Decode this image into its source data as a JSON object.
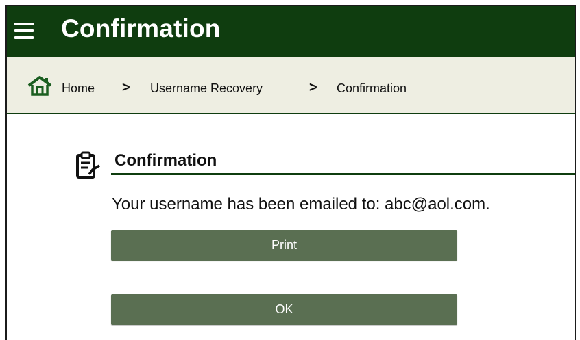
{
  "header": {
    "title": "Confirmation",
    "menu_icon": "hamburger-menu-icon",
    "background": "#0f3d0f"
  },
  "breadcrumb": {
    "home_icon": "home-icon",
    "items": [
      "Home",
      "Username Recovery",
      "Confirmation"
    ],
    "separator": ">",
    "background": "#eeeee2"
  },
  "section": {
    "icon": "clipboard-check-icon",
    "title": "Confirmation",
    "message": "Your username has been emailed to: abc@aol.com."
  },
  "buttons": {
    "print_label": "Print",
    "ok_label": "OK",
    "color": "#5a6f52"
  }
}
